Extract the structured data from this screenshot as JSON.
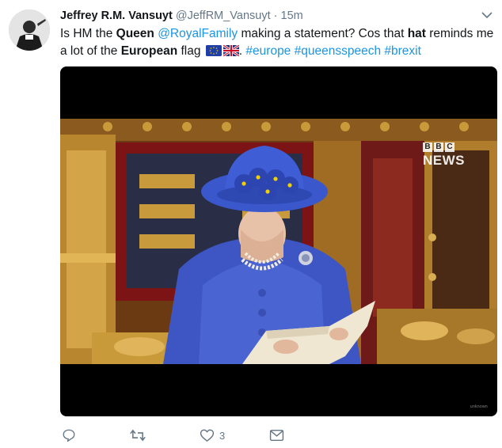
{
  "tweet": {
    "display_name": "Jeffrey R.M. Vansuyt",
    "handle": "@JeffRM_Vansuyt",
    "separator": "·",
    "time": "15m",
    "text": {
      "line1": [
        {
          "t": "Is HM the ",
          "s": "plain"
        },
        {
          "t": "Queen",
          "s": "bold"
        },
        {
          "t": " ",
          "s": "plain"
        },
        {
          "t": "@RoyalFamily",
          "s": "link"
        },
        {
          "t": " making a statement? Cos that ",
          "s": "plain"
        },
        {
          "t": "hat",
          "s": "bold"
        },
        {
          "t": " reminds me",
          "s": "plain"
        }
      ],
      "line2_before_flags": [
        {
          "t": "a lot of the ",
          "s": "plain"
        },
        {
          "t": "European",
          "s": "bold"
        },
        {
          "t": " flag ",
          "s": "plain"
        }
      ],
      "line2_after_flags": [
        {
          "t": ". ",
          "s": "plain"
        },
        {
          "t": "#europe",
          "s": "link"
        },
        {
          "t": " ",
          "s": "plain"
        },
        {
          "t": "#queensspeech",
          "s": "link"
        },
        {
          "t": " ",
          "s": "plain"
        },
        {
          "t": "#brexit",
          "s": "link"
        }
      ]
    },
    "flags": [
      "eu-flag-icon",
      "uk-flag-icon"
    ],
    "media": {
      "overlay_logo_letters": [
        "B",
        "B",
        "C"
      ],
      "overlay_logo_word": "NEWS",
      "watermark": "unknown"
    },
    "actions": {
      "reply_icon": "reply-icon",
      "retweet_icon": "retweet-icon",
      "like_icon": "heart-icon",
      "like_count": "3",
      "dm_icon": "envelope-icon"
    }
  },
  "colors": {
    "link": "#1b95e0",
    "secondary": "#657786",
    "text": "#14171a"
  }
}
